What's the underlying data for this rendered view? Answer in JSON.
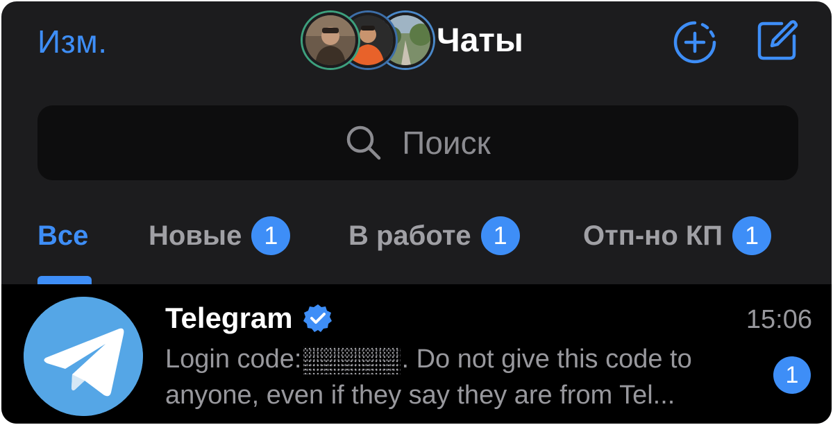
{
  "header": {
    "edit_label": "Изм.",
    "title": "Чаты",
    "icons": {
      "new_story": "add-circle-dashed-icon",
      "compose": "compose-icon"
    }
  },
  "search": {
    "placeholder": "Поиск",
    "icon": "search-icon"
  },
  "tabs": [
    {
      "label": "Все",
      "badge": null,
      "active": true
    },
    {
      "label": "Новые",
      "badge": "1",
      "active": false
    },
    {
      "label": "В работе",
      "badge": "1",
      "active": false
    },
    {
      "label": "Отп-но КП",
      "badge": "1",
      "active": false
    }
  ],
  "chats": [
    {
      "name": "Telegram",
      "verified": true,
      "time": "15:06",
      "preview_line1_before": "Login code:",
      "preview_line1_after": ". Do not give this code to",
      "preview_line2": "anyone, even if they say they are from Tel...",
      "unread": "1"
    }
  ],
  "colors": {
    "accent": "#3e8ef7",
    "background": "#1c1c1e",
    "list_background": "#000000",
    "telegram_avatar": "#55a6e6"
  }
}
